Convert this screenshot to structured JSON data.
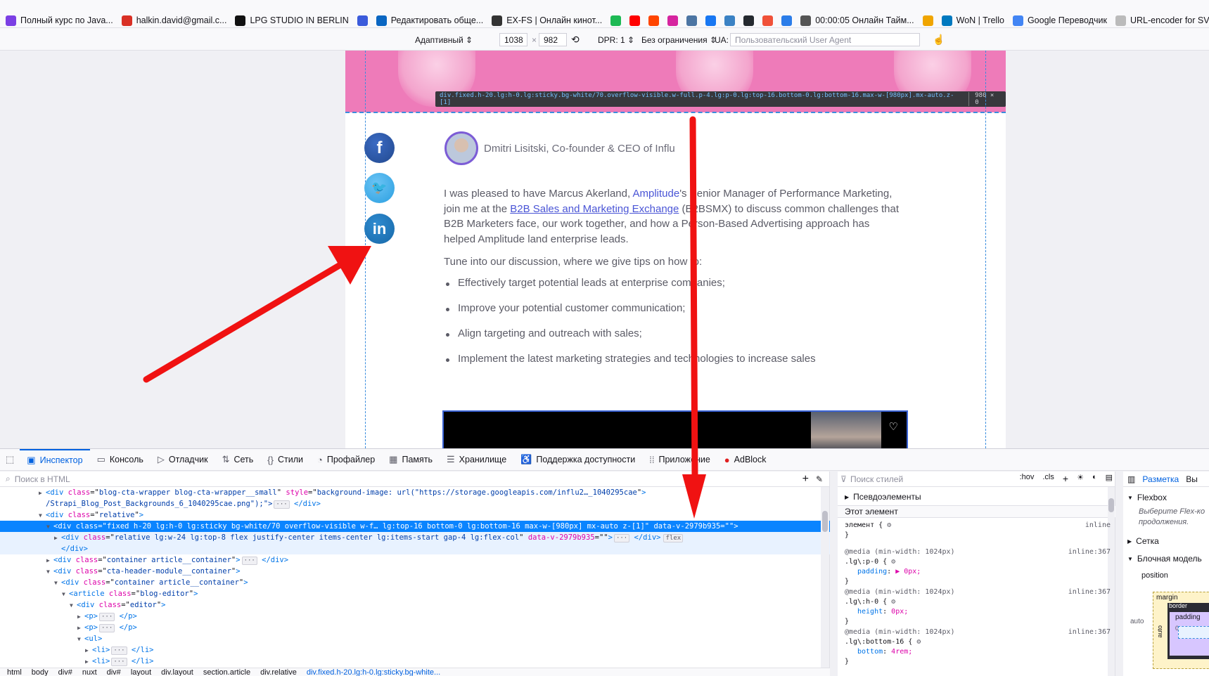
{
  "bookmarks": {
    "items": [
      {
        "label": "Полный курс по Java...",
        "icon": "course-icon",
        "color": "#7b3fe4"
      },
      {
        "label": "halkin.david@gmail.c...",
        "icon": "gmail-icon",
        "color": "#d93025"
      },
      {
        "label": "LPG STUDIO IN BERLIN",
        "icon": "lpg-icon",
        "color": "#111111"
      },
      {
        "label": "",
        "icon": "mail-icon",
        "color": "#3b5bdb"
      },
      {
        "label": "Редактировать обще...",
        "icon": "linkedin-icon",
        "color": "#0a66c2"
      },
      {
        "label": "EX-FS | Онлайн кинот...",
        "icon": "exfs-icon",
        "color": "#333333"
      },
      {
        "label": "",
        "icon": "spotify-icon",
        "color": "#1db954"
      },
      {
        "label": "",
        "icon": "youtube-icon",
        "color": "#ff0000"
      },
      {
        "label": "",
        "icon": "reddit-icon",
        "color": "#ff4500"
      },
      {
        "label": "",
        "icon": "instagram-icon",
        "color": "#d6249f"
      },
      {
        "label": "",
        "icon": "vk-icon",
        "color": "#4c75a3"
      },
      {
        "label": "",
        "icon": "facebook-icon",
        "color": "#1877f2"
      },
      {
        "label": "",
        "icon": "codepen-icon",
        "color": "#3b82c4"
      },
      {
        "label": "",
        "icon": "github-icon",
        "color": "#24292f"
      },
      {
        "label": "",
        "icon": "swift-icon",
        "color": "#f05138"
      },
      {
        "label": "",
        "icon": "app-icon",
        "color": "#2b7de9"
      },
      {
        "label": "00:00:05 Онлайн Тайм...",
        "icon": "timer-icon",
        "color": "#555555"
      },
      {
        "label": "",
        "icon": "figure-icon",
        "color": "#f0a500"
      },
      {
        "label": "WoN | Trello",
        "icon": "trello-icon",
        "color": "#0079bf"
      },
      {
        "label": "Google Переводчик",
        "icon": "translate-icon",
        "color": "#4285f4"
      },
      {
        "label": "URL-encoder for SVG",
        "icon": "svg-encoder-icon",
        "color": "#bbbbbb"
      },
      {
        "label": "",
        "icon": "extra-icon",
        "color": "#333333"
      }
    ]
  },
  "rdm": {
    "mode": "Адаптивный ⇕",
    "width": "1038",
    "times": "×",
    "height": "982",
    "dpr": "DPR: 1 ⇕",
    "throttle": "Без ограничения ⇕",
    "ua_label": "UA:",
    "ua_placeholder": "Пользовательский User Agent"
  },
  "page": {
    "tooltip_selector": "div.fixed.h-20.lg:h-0.lg:sticky.bg-white/70.overflow-visible.w-full.p-4.lg:p-0.lg:top-16.bottom-0.lg:bottom-16.max-w-[980px].mx-auto.z-[1]",
    "tooltip_size": "980 × 0",
    "author": "Dmitri Lisitski, Co-founder & CEO of Influ",
    "p1_a": "I was pleased to have Marcus Akerland, ",
    "p1_link1": "Amplitude",
    "p1_b": "'s Senior Manager of Performance Marketing, join me at the ",
    "p1_link2": "B2B Sales and Marketing Exchange",
    "p1_c": " (B2BSMX) to discuss common challenges that B2B Marketers face, our work together, and how a Person-Based Advertising approach has helped Amplitude land enterprise leads.",
    "p2": "Tune into our discussion, where we give tips on how to:",
    "list": [
      "Effectively target potential leads at enterprise companies;",
      "Improve your potential customer communication;",
      "Align targeting and outreach with sales;",
      "Implement the latest marketing strategies and technologies to increase sales"
    ],
    "social_facebook": "f",
    "social_twitter": "🐦",
    "social_linkedin": "in"
  },
  "devtools": {
    "tabs": [
      {
        "label": "Инспектор",
        "icon": "inspector-icon"
      },
      {
        "label": "Консоль",
        "icon": "console-icon"
      },
      {
        "label": "Отладчик",
        "icon": "debugger-icon"
      },
      {
        "label": "Сеть",
        "icon": "network-icon"
      },
      {
        "label": "Стили",
        "icon": "styles-icon"
      },
      {
        "label": "Профайлер",
        "icon": "profiler-icon"
      },
      {
        "label": "Память",
        "icon": "memory-icon"
      },
      {
        "label": "Хранилище",
        "icon": "storage-icon"
      },
      {
        "label": "Поддержка доступности",
        "icon": "accessibility-icon"
      },
      {
        "label": "Приложение",
        "icon": "application-icon"
      },
      {
        "label": "AdBlock",
        "icon": "adblock-icon"
      }
    ],
    "html_search": "Поиск в HTML",
    "tree": [
      {
        "tw": "▶",
        "tag": "div",
        "attrs": [
          [
            "class",
            "blog-cta-wrapper blog-cta-wrapper__small"
          ],
          [
            "style",
            "background-image: url(\"https://storage.googleapis.com/influ2…_1040295cae"
          ]
        ],
        "tail": "",
        "indent": 5
      },
      {
        "tw": "",
        "raw": "/Strapi_Blog_Post_Backgrounds_6_1040295cae.png\");\">",
        "tail": " </div>",
        "indent": 5
      },
      {
        "tw": "▼",
        "tag": "div",
        "attrs": [
          [
            "class",
            "relative"
          ]
        ],
        "tail": "",
        "indent": 5
      },
      {
        "tw": "▼",
        "tag": "div",
        "attrs": [
          [
            "class",
            "fixed h-20 lg:h-0 lg:sticky bg-white/70 overflow-visible w-f… lg:top-16 bottom-0 lg:bottom-16 max-w-[980px] mx-auto z-[1]"
          ],
          [
            "data-v-2979b935",
            ""
          ]
        ],
        "tail": "",
        "indent": 6,
        "sel": true
      },
      {
        "tw": "▶",
        "tag": "div",
        "attrs": [
          [
            "class",
            "relative lg:w-24 lg:top-8 flex justify-center items-center lg:items-start gap-4 lg:flex-col"
          ],
          [
            "data-v-2979b935",
            ""
          ]
        ],
        "tail": " </div>",
        "badge": "flex",
        "indent": 7,
        "hov": true
      },
      {
        "tw": "",
        "close": "div",
        "indent": 7,
        "hov": true
      },
      {
        "tw": "▶",
        "tag": "div",
        "attrs": [
          [
            "class",
            "container article__container"
          ]
        ],
        "tail": " </div>",
        "indent": 6
      },
      {
        "tw": "▼",
        "tag": "div",
        "attrs": [
          [
            "class",
            "cta-header-module__container"
          ]
        ],
        "tail": "",
        "indent": 6
      },
      {
        "tw": "▼",
        "tag": "div",
        "attrs": [
          [
            "class",
            "container article__container"
          ]
        ],
        "tail": "",
        "indent": 7
      },
      {
        "tw": "▼",
        "tag": "article",
        "attrs": [
          [
            "class",
            "blog-editor"
          ]
        ],
        "tail": "",
        "indent": 8
      },
      {
        "tw": "▼",
        "tag": "div",
        "attrs": [
          [
            "class",
            "editor"
          ]
        ],
        "tail": "",
        "indent": 9
      },
      {
        "tw": "▶",
        "tag": "p",
        "attrs": [],
        "tail": " </p>",
        "indent": 10
      },
      {
        "tw": "▶",
        "tag": "p",
        "attrs": [],
        "tail": " </p>",
        "indent": 10
      },
      {
        "tw": "▼",
        "tag": "ul",
        "attrs": [],
        "tail": "",
        "indent": 10
      },
      {
        "tw": "▶",
        "tag": "li",
        "attrs": [],
        "tail": " </li>",
        "indent": 11
      },
      {
        "tw": "▶",
        "tag": "li",
        "attrs": [],
        "tail": " </li>",
        "indent": 11
      }
    ],
    "breadcrumbs": [
      "html",
      "body",
      "div#",
      "nuxt",
      "div#",
      "layout",
      "div.layout",
      "section.article",
      "div.relative",
      "div.fixed.h-20.lg:h-0.lg:sticky.bg-white..."
    ],
    "rules_search": "Поиск стилей",
    "rules_tools": [
      ":hov",
      ".cls",
      "+"
    ],
    "pseudo": "Псевдоэлементы",
    "this_element": "Этот элемент",
    "rules": [
      {
        "media": "",
        "selector": "элемент {",
        "src": "inline",
        "decls": []
      },
      {
        "media": "@media (min-width: 1024px)",
        "selector": ".lg\\:p-0 {",
        "src": "inline:367",
        "decls": [
          [
            "padding",
            "▶ 0px;"
          ]
        ]
      },
      {
        "media": "@media (min-width: 1024px)",
        "selector": ".lg\\:h-0 {",
        "src": "inline:367",
        "decls": [
          [
            "height",
            "0px;"
          ]
        ]
      },
      {
        "media": "@media (min-width: 1024px)",
        "selector": ".lg\\:bottom-16 {",
        "src": "inline:367",
        "decls": [
          [
            "bottom",
            "4rem;"
          ]
        ]
      }
    ],
    "layout_tab": "Разметка",
    "layout_tab2": "Вы",
    "flexbox": "Flexbox",
    "flexbox_hint": "Выберите Flex-ко продолжения.",
    "grid": "Сетка",
    "boxmodel": "Блочная модель",
    "position": "position",
    "margin": "margin",
    "border": "border",
    "padding": "padding",
    "auto": "auto",
    "zero": "0"
  }
}
